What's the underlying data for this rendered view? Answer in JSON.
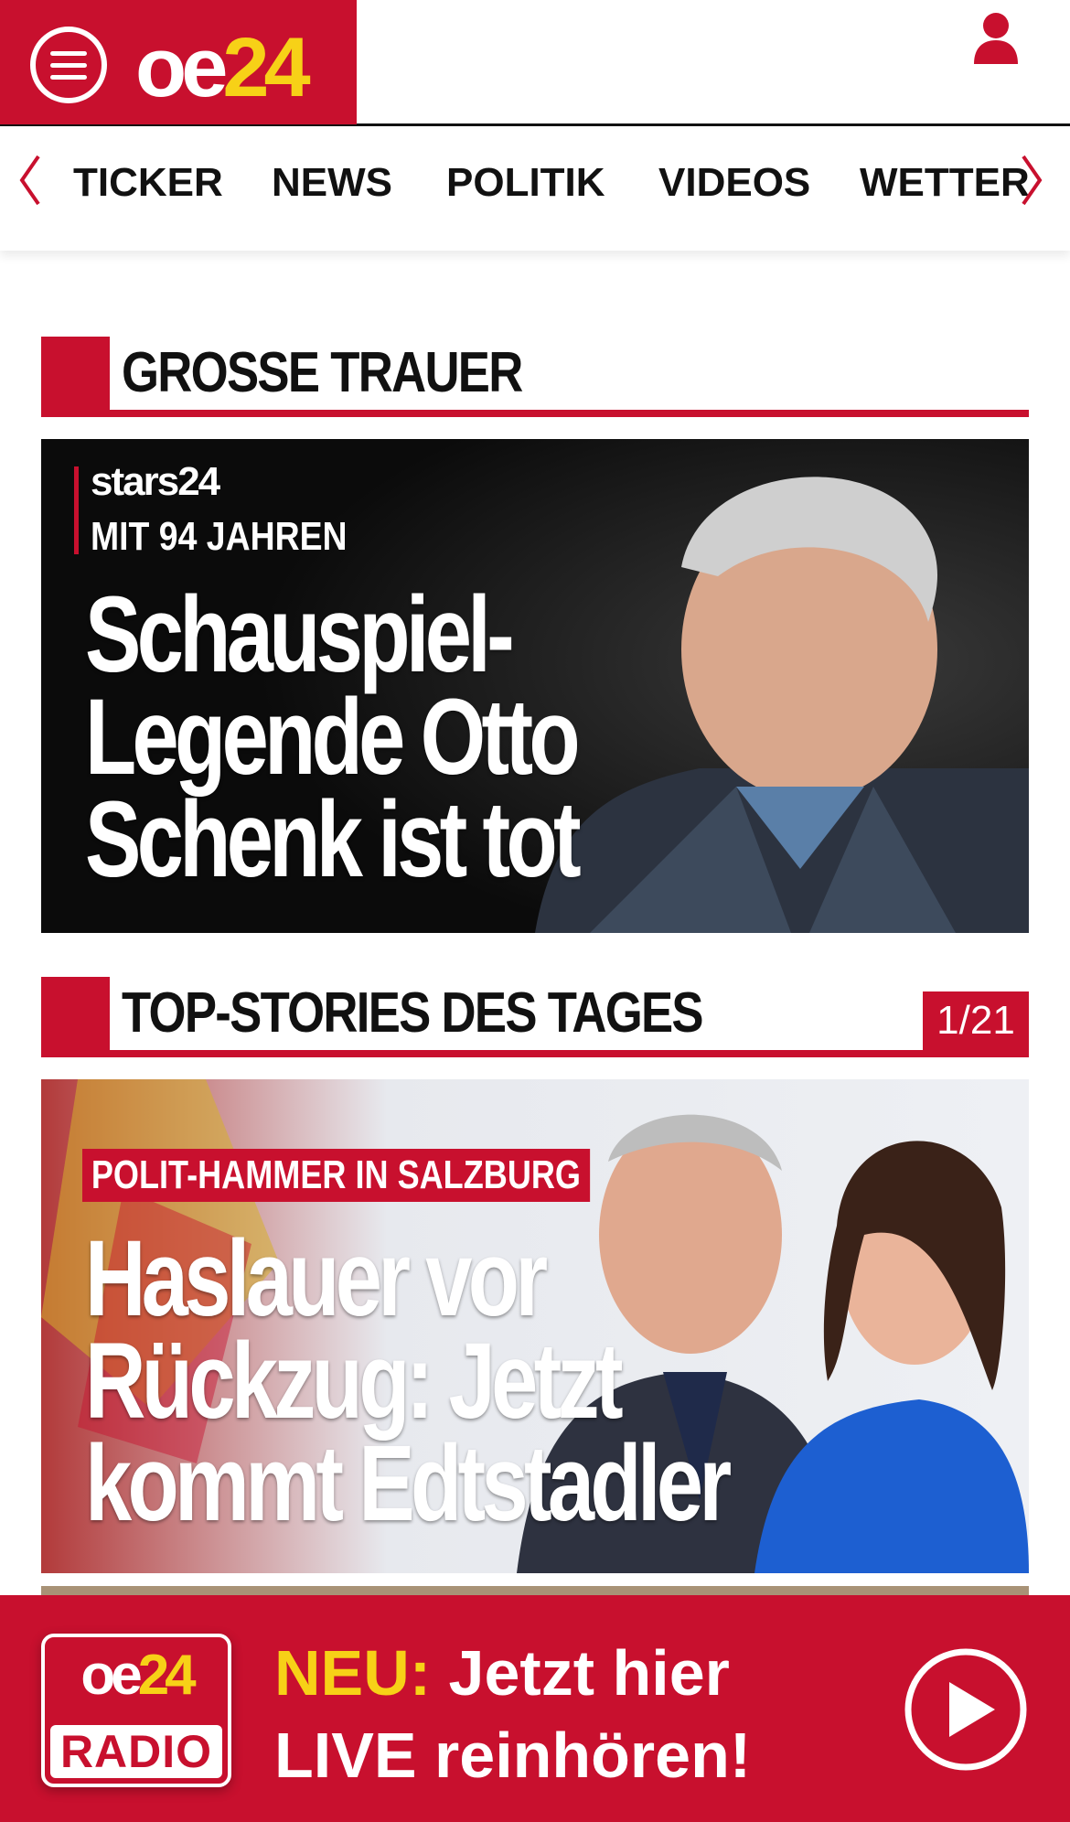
{
  "header": {
    "logo": {
      "part1": "oe",
      "part2": "24"
    },
    "colors": {
      "brand_red": "#c8102e",
      "brand_yellow": "#f7d117"
    }
  },
  "nav": {
    "items": [
      {
        "label": "TICKER"
      },
      {
        "label": "NEWS"
      },
      {
        "label": "POLITIK"
      },
      {
        "label": "VIDEOS"
      },
      {
        "label": "WETTER"
      }
    ]
  },
  "sections": [
    {
      "title": "GROSSE TRAUER",
      "article": {
        "brand": "stars24",
        "kicker": "MIT 94 JAHREN",
        "headline_lines": [
          "Schauspiel-",
          "Legende Otto",
          "Schenk ist tot"
        ]
      }
    },
    {
      "title": "TOP-STORIES DES TAGES",
      "counter": "1/21",
      "article": {
        "kicker": "POLIT-HAMMER IN SALZBURG",
        "headline_lines": [
          "Haslauer vor",
          "Rückzug: Jetzt",
          "kommt Edtstadler"
        ]
      }
    }
  ],
  "radio": {
    "logo_top_part1": "oe",
    "logo_top_part2": "24",
    "logo_bottom": "RADIO",
    "neu": "NEU:",
    "line1_rest": " Jetzt hier",
    "line2": "LIVE reinhören!"
  }
}
